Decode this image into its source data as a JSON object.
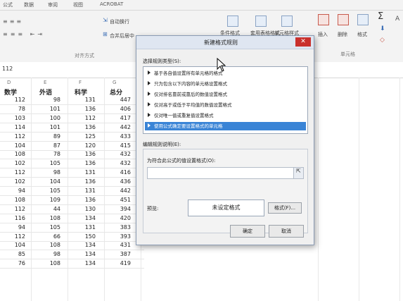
{
  "ribbon": {
    "tabs": [
      "公式",
      "数据",
      "审阅",
      "视图",
      "ACROBAT"
    ],
    "items": {
      "auto_wrap": "自动换行",
      "merge_center": "合并后居中",
      "conditional_format": "条件格式",
      "table_format": "套用表格格式",
      "cell_style": "单元格样式",
      "insert": "插入",
      "delete": "删除",
      "format": "格式",
      "sum_symbol": "Σ"
    },
    "groups": {
      "alignment": "对齐方式",
      "cells": "单元格"
    }
  },
  "formula_bar": {
    "value": "112"
  },
  "sheet": {
    "col_letters": [
      "D",
      "E",
      "F",
      "G"
    ],
    "headers": [
      "数学",
      "外语",
      "科学",
      "总分"
    ],
    "rows": [
      [
        "112",
        "98",
        "131",
        "447"
      ],
      [
        "78",
        "101",
        "136",
        "406"
      ],
      [
        "103",
        "100",
        "112",
        "417"
      ],
      [
        "114",
        "101",
        "136",
        "442"
      ],
      [
        "112",
        "89",
        "125",
        "433"
      ],
      [
        "104",
        "87",
        "120",
        "415"
      ],
      [
        "108",
        "78",
        "136",
        "432"
      ],
      [
        "102",
        "105",
        "136",
        "432"
      ],
      [
        "112",
        "98",
        "131",
        "416"
      ],
      [
        "102",
        "104",
        "136",
        "436"
      ],
      [
        "94",
        "105",
        "131",
        "442"
      ],
      [
        "108",
        "109",
        "136",
        "451"
      ],
      [
        "112",
        "44",
        "130",
        "394"
      ],
      [
        "116",
        "108",
        "134",
        "420"
      ],
      [
        "94",
        "105",
        "131",
        "383"
      ],
      [
        "112",
        "66",
        "150",
        "393"
      ],
      [
        "104",
        "108",
        "134",
        "431"
      ],
      [
        "85",
        "98",
        "134",
        "387"
      ],
      [
        "76",
        "108",
        "134",
        "419"
      ]
    ]
  },
  "dialog": {
    "title": "新建格式规则",
    "close": "✕",
    "select_type_label": "选择规则类型(S):",
    "rules": [
      "基于各自值设置所有单元格的格式",
      "只为包含以下内容的单元格设置格式",
      "仅对排名靠前或靠后的数值设置格式",
      "仅对高于或低于平均值的数值设置格式",
      "仅对唯一值或重复值设置格式",
      "使用公式确定要设置格式的单元格"
    ],
    "selected_rule_index": 5,
    "edit_desc_label": "编辑规则说明(E):",
    "formula_label": "为符合此公式的值设置格式(O):",
    "formula_value": "",
    "preview_label": "预览:",
    "preview_text": "未设定格式",
    "format_button": "格式(F)...",
    "ok_button": "确定",
    "cancel_button": "取消"
  }
}
